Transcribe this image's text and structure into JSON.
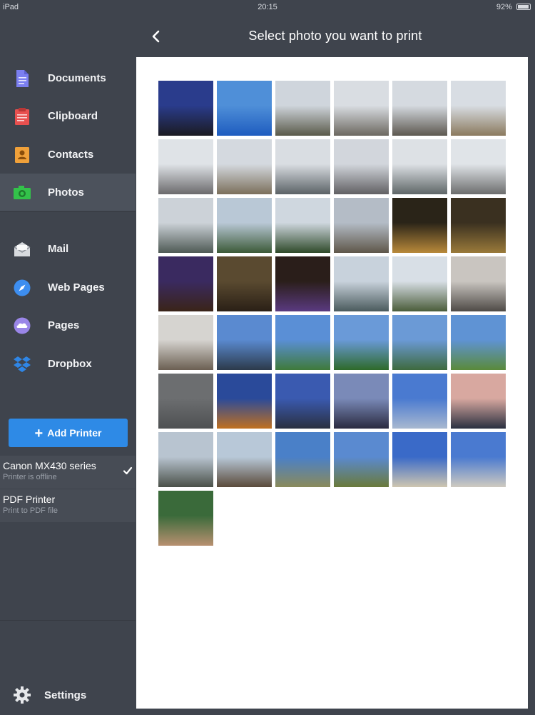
{
  "statusbar": {
    "device": "iPad",
    "time": "20:15",
    "battery": "92%",
    "battery_level": 0.92
  },
  "header": {
    "title": "Select photo you want to print"
  },
  "sidebar": {
    "items": [
      {
        "label": "Documents",
        "icon": "document-icon",
        "color": "#7b7ff0"
      },
      {
        "label": "Clipboard",
        "icon": "clipboard-icon",
        "color": "#e8504f"
      },
      {
        "label": "Contacts",
        "icon": "contacts-icon",
        "color": "#f0a13a"
      },
      {
        "label": "Photos",
        "icon": "camera-icon",
        "color": "#33c24a"
      },
      {
        "label": "Mail",
        "icon": "mail-icon",
        "color": "#d7dade"
      },
      {
        "label": "Web Pages",
        "icon": "compass-icon",
        "color": "#3d8ef0"
      },
      {
        "label": "Pages",
        "icon": "cloud-icon",
        "color": "#9a86e8"
      },
      {
        "label": "Dropbox",
        "icon": "dropbox-icon",
        "color": "#2f86e6"
      }
    ],
    "add_printer_label": "Add Printer",
    "printers": [
      {
        "name": "Canon MX430 series",
        "status": "Printer is offline",
        "selected": true
      },
      {
        "name": "PDF Printer",
        "status": "Print to PDF file",
        "selected": false
      }
    ],
    "settings_label": "Settings"
  },
  "photos": {
    "count": 43,
    "items": [
      {
        "top": "#2a3c8c",
        "bottom": "#1b1b22"
      },
      {
        "top": "#4f8fd8",
        "bottom": "#1e5cbf"
      },
      {
        "top": "#cfd5dc",
        "bottom": "#5a5a4a"
      },
      {
        "top": "#d9dde2",
        "bottom": "#6c6860"
      },
      {
        "top": "#d5dae0",
        "bottom": "#5d5850"
      },
      {
        "top": "#d8dde3",
        "bottom": "#8b7a5e"
      },
      {
        "top": "#dfe3e7",
        "bottom": "#6b6a6c"
      },
      {
        "top": "#d4d9df",
        "bottom": "#7b6f5b"
      },
      {
        "top": "#d9dde2",
        "bottom": "#5b6266"
      },
      {
        "top": "#d2d6dc",
        "bottom": "#616063"
      },
      {
        "top": "#dde1e5",
        "bottom": "#5e6667"
      },
      {
        "top": "#e0e4e8",
        "bottom": "#6c6d6d"
      },
      {
        "top": "#ccd2d8",
        "bottom": "#4f5a55"
      },
      {
        "top": "#b9c8d6",
        "bottom": "#3c5a38"
      },
      {
        "top": "#cfd7df",
        "bottom": "#2f4a2a"
      },
      {
        "top": "#b4bcc6",
        "bottom": "#5f574a"
      },
      {
        "top": "#2a2418",
        "bottom": "#b8893a"
      },
      {
        "top": "#3a3020",
        "bottom": "#9a7a3a"
      },
      {
        "top": "#3a2a60",
        "bottom": "#3a2418"
      },
      {
        "top": "#5a4a30",
        "bottom": "#2a2016"
      },
      {
        "top": "#2a1e1a",
        "bottom": "#5a3a80"
      },
      {
        "top": "#c8d2dc",
        "bottom": "#4a5a5c"
      },
      {
        "top": "#d8dfe6",
        "bottom": "#4a5c3a"
      },
      {
        "top": "#c9c5c0",
        "bottom": "#4e4a46"
      },
      {
        "top": "#d6d4d0",
        "bottom": "#6b5f52"
      },
      {
        "top": "#5a8ad0",
        "bottom": "#2c3a4a"
      },
      {
        "top": "#5a8fd6",
        "bottom": "#3f7a3a"
      },
      {
        "top": "#6a9ad8",
        "bottom": "#2e6a2a"
      },
      {
        "top": "#6b9ad6",
        "bottom": "#3e6a3e"
      },
      {
        "top": "#5f93d4",
        "bottom": "#5a8a3a"
      },
      {
        "top": "#6c6e70",
        "bottom": "#4e5052"
      },
      {
        "top": "#2a4a9a",
        "bottom": "#c07020"
      },
      {
        "top": "#3a5ab0",
        "bottom": "#2a3040"
      },
      {
        "top": "#7a8ab8",
        "bottom": "#2a2a40"
      },
      {
        "top": "#4a7ad0",
        "bottom": "#a8b8d0"
      },
      {
        "top": "#d8a8a0",
        "bottom": "#2a3040"
      },
      {
        "top": "#b8c4d0",
        "bottom": "#4a5048"
      },
      {
        "top": "#b8c8d8",
        "bottom": "#5a4a3a"
      },
      {
        "top": "#4a80c8",
        "bottom": "#8a8a5a"
      },
      {
        "top": "#5a8ad0",
        "bottom": "#6a7a3a"
      },
      {
        "top": "#3a6ac8",
        "bottom": "#cfc6b0"
      },
      {
        "top": "#4a7ad0",
        "bottom": "#cfcac0"
      },
      {
        "top": "#3a6a3a",
        "bottom": "#b89070"
      }
    ]
  }
}
